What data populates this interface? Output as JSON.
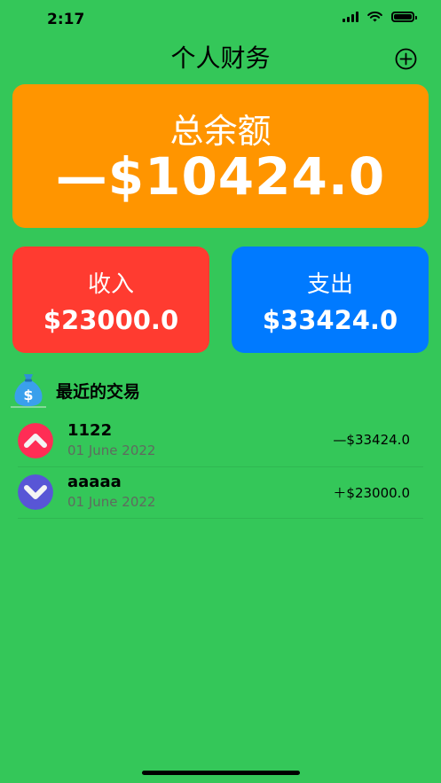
{
  "status_bar": {
    "time": "2:17"
  },
  "nav": {
    "title": "个人财务",
    "add_icon": "plus-circle-icon"
  },
  "total": {
    "label": "总余额",
    "amount": "—$10424.0",
    "color": "#ff9500"
  },
  "income": {
    "label": "收入",
    "amount": "$23000.0",
    "color": "#ff3b30"
  },
  "expense": {
    "label": "支出",
    "amount": "$33424.0",
    "color": "#007aff"
  },
  "recent": {
    "icon": "money-bag-icon",
    "title": "最近的交易",
    "transactions": [
      {
        "name": "1122",
        "date": "01 June 2022",
        "amount": "—$33424.0",
        "icon": "chevron-up-icon",
        "icon_color": "#ff2d55"
      },
      {
        "name": "aaaaa",
        "date": "01 June 2022",
        "amount": "＋$23000.0",
        "icon": "chevron-down-icon",
        "icon_color": "#5856d6"
      }
    ]
  },
  "theme": {
    "background": "#34c759"
  }
}
